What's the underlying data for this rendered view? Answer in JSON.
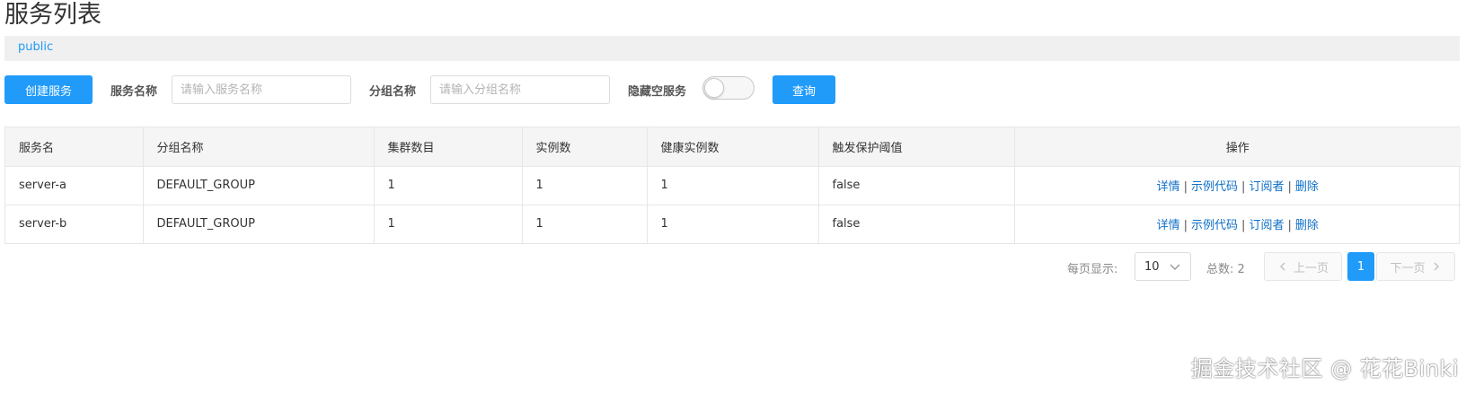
{
  "page_title": "服务列表",
  "namespace": {
    "label": "public"
  },
  "toolbar": {
    "create_label": "创建服务",
    "service_name_label": "服务名称",
    "service_name_placeholder": "请输入服务名称",
    "group_name_label": "分组名称",
    "group_name_placeholder": "请输入分组名称",
    "hide_empty_label": "隐藏空服务",
    "hide_empty_on": false,
    "query_label": "查询"
  },
  "table": {
    "headers": [
      "服务名",
      "分组名称",
      "集群数目",
      "实例数",
      "健康实例数",
      "触发保护阈值",
      "操作"
    ],
    "rows": [
      {
        "service": "server-a",
        "group": "DEFAULT_GROUP",
        "clusters": "1",
        "instances": "1",
        "healthy": "1",
        "protect": "false"
      },
      {
        "service": "server-b",
        "group": "DEFAULT_GROUP",
        "clusters": "1",
        "instances": "1",
        "healthy": "1",
        "protect": "false"
      }
    ],
    "ops": {
      "detail": "详情",
      "sample": "示例代码",
      "subscriber": "订阅者",
      "delete": "删除",
      "sep": "|"
    }
  },
  "pager": {
    "per_page_label": "每页显示:",
    "per_page_value": "10",
    "total_label": "总数: 2",
    "prev_label": "上一页",
    "current_page": "1",
    "next_label": "下一页"
  },
  "watermark": "掘金技术社区 @ 花花Binki",
  "colors": {
    "primary": "#209bfa",
    "link": "#0f6fc6",
    "header_bg": "#f5f5f5",
    "ns_bar_bg": "#f0f0f0"
  },
  "icons": {
    "dropdown": "chevron-down-icon",
    "prev": "chevron-left-icon",
    "next": "chevron-right-icon"
  }
}
